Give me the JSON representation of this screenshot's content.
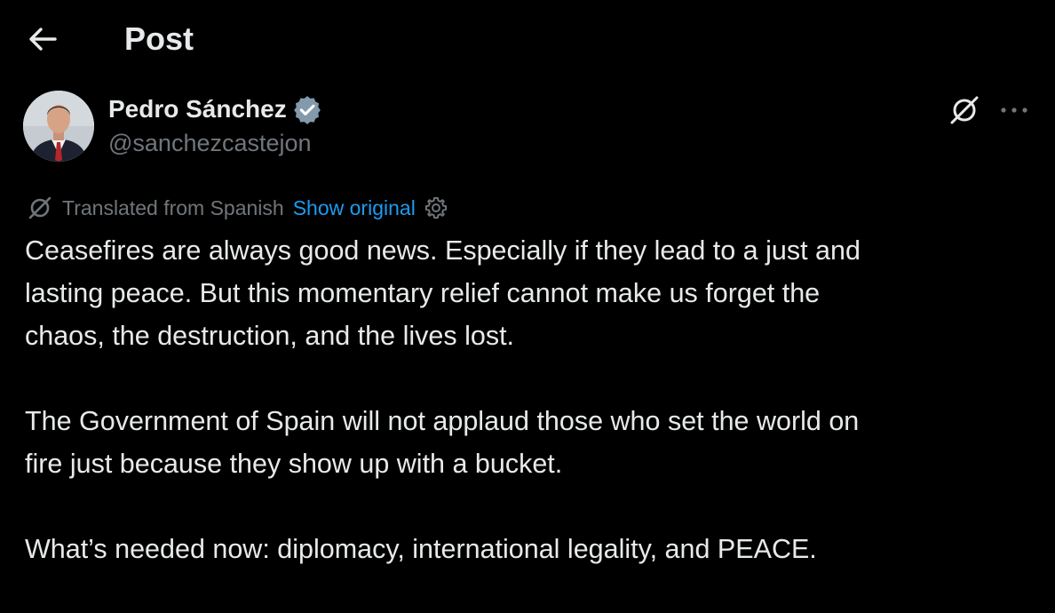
{
  "header": {
    "title": "Post"
  },
  "post": {
    "author": {
      "display_name": "Pedro Sánchez",
      "handle": "@sanchezcastejon"
    },
    "translation": {
      "label": "Translated from Spanish",
      "show_original": "Show original"
    },
    "paragraphs": [
      "Ceasefires are always good news. Especially if they lead to a just and\nlasting peace. But this momentary relief cannot make us forget the\nchaos, the destruction, and the lives lost.",
      "The Government of Spain will not applaud those who set the world on\nfire just because they show up with a bucket.",
      "What’s needed now: diplomacy, international legality, and PEACE."
    ]
  },
  "icons": {
    "back": "arrow-left-icon",
    "verified": "verified-badge-icon",
    "grok": "grok-icon",
    "more": "more-horizontal-icon",
    "translate": "grok-icon",
    "settings": "gear-icon"
  },
  "colors": {
    "background": "#000000",
    "text": "#e7e9ea",
    "secondary": "#71767b",
    "link": "#1d9bf0",
    "verified": "#829aab"
  }
}
